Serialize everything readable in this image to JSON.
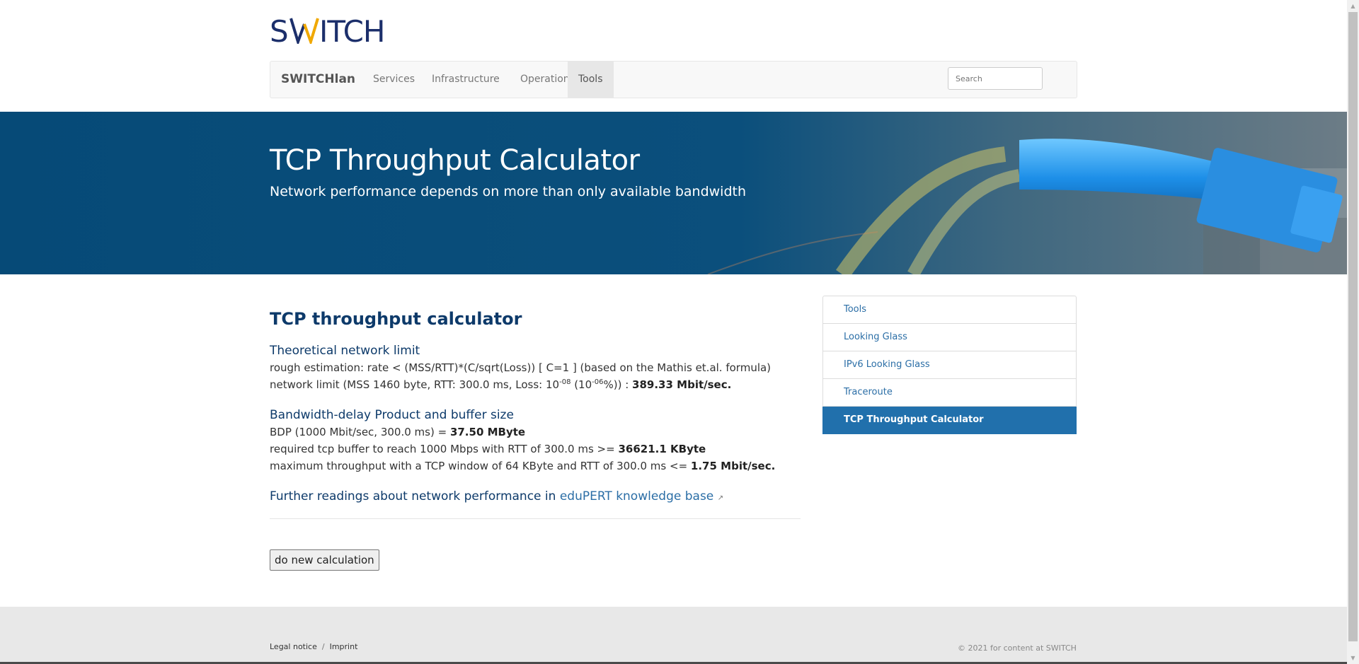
{
  "logo": {
    "text": "SWITCH",
    "colors": {
      "main": "#1c2f6b",
      "accent": "#f0a800"
    }
  },
  "navbar": {
    "brand": "SWITCHlan",
    "items": [
      {
        "label": "Services"
      },
      {
        "label": "Infrastructure"
      },
      {
        "label": "Operations"
      },
      {
        "label": "Tools"
      }
    ],
    "active": "Tools",
    "search_placeholder": "Search"
  },
  "hero": {
    "title": "TCP Throughput Calculator",
    "subtitle": "Network performance depends on more than only available bandwidth"
  },
  "main": {
    "title": "TCP throughput calculator",
    "section1": {
      "heading": "Theoretical network limit",
      "line1": "rough estimation: rate < (MSS/RTT)*(C/sqrt(Loss)) [ C=1 ] (based on the Mathis et.al. formula)",
      "line2_prefix": "network limit (MSS 1460 byte, RTT: 300.0 ms, Loss: 10",
      "line2_exp1": "-08",
      "line2_mid": " (10",
      "line2_exp2": "-06",
      "line2_suffix": "%)) : ",
      "line2_value": "389.33 Mbit/sec."
    },
    "section2": {
      "heading": "Bandwidth-delay Product and buffer size",
      "bdp_prefix": "BDP (1000 Mbit/sec, 300.0 ms) = ",
      "bdp_value": "37.50 MByte",
      "buffer_prefix": "required tcp buffer to reach 1000 Mbps with RTT of 300.0 ms >= ",
      "buffer_value": "36621.1 KByte",
      "max_prefix": "maximum throughput with a TCP window of 64 KByte and RTT of 300.0 ms <= ",
      "max_value": "1.75 Mbit/sec."
    },
    "further_prefix": "Further readings about network performance in ",
    "further_link": "eduPERT knowledge base",
    "button": "do new calculation"
  },
  "sidebar": {
    "items": [
      {
        "label": "Tools"
      },
      {
        "label": "Looking Glass"
      },
      {
        "label": "IPv6 Looking Glass"
      },
      {
        "label": "Traceroute"
      },
      {
        "label": "TCP Throughput Calculator"
      }
    ],
    "active": "TCP Throughput Calculator"
  },
  "footer": {
    "legal": "Legal notice",
    "separator": "/",
    "imprint": "Imprint",
    "copyright": "© 2021 for content at SWITCH"
  }
}
